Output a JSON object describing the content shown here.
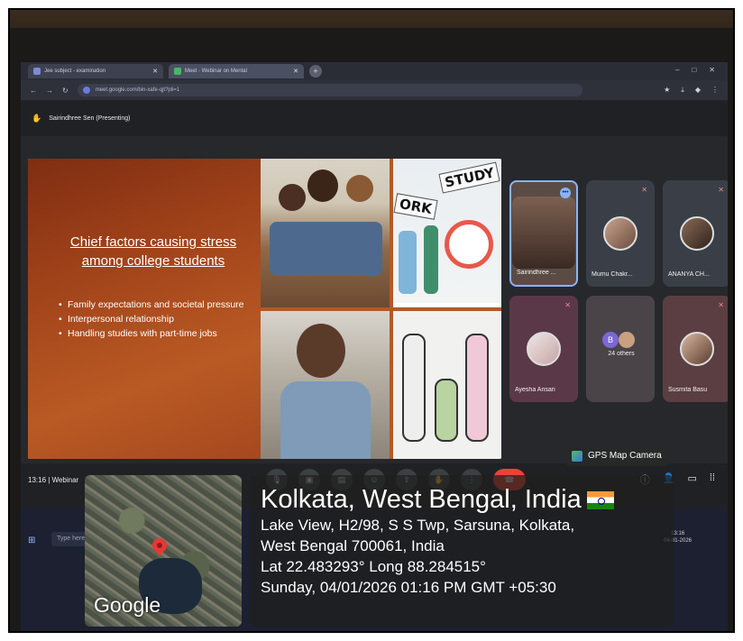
{
  "browser": {
    "tabs": [
      {
        "label": "Jee subject - examination",
        "active": false
      },
      {
        "label": "Meet - Webinar on Mental",
        "active": true
      }
    ],
    "url": "meet.google.com/bin-xafe-qjt?pli=1"
  },
  "meet": {
    "presenter": "Sairindhree Sen (Presenting)",
    "time": "13:16",
    "meeting_name": "Webinar",
    "participants": [
      {
        "name": "Sairindhree ...",
        "active": true
      },
      {
        "name": "Mumu Chakr...",
        "active": false
      },
      {
        "name": "ANANYA CH...",
        "active": false
      },
      {
        "name": "Ayesha Ansari",
        "active": false
      },
      {
        "name": "24 others",
        "active": false,
        "others": true,
        "badge": "B"
      },
      {
        "name": "Susmita Basu",
        "active": false
      }
    ]
  },
  "slide": {
    "title": "Chief factors causing stress among college students",
    "bullets": [
      "Family expectations and societal pressure",
      "Interpersonal relationship",
      "Handling studies with part-time jobs"
    ],
    "signs": [
      "STUDY",
      "ORK"
    ]
  },
  "taskbar": {
    "search_placeholder": "Type here to search"
  },
  "gps": {
    "app_name": "GPS Map Camera",
    "map_logo": "Google",
    "city": "Kolkata, West Bengal, India",
    "address_line1": "Lake View, H2/98, S S Twp, Sarsuna, Kolkata,",
    "address_line2": "West Bengal 700061, India",
    "coords": "Lat 22.483293° Long 88.284515°",
    "datetime": "Sunday, 04/01/2026 01:16 PM GMT +05:30"
  },
  "colors": {
    "slide_accent": "#b25a26",
    "meet_blue": "#8ab4f8",
    "end_call": "#ea4335"
  }
}
